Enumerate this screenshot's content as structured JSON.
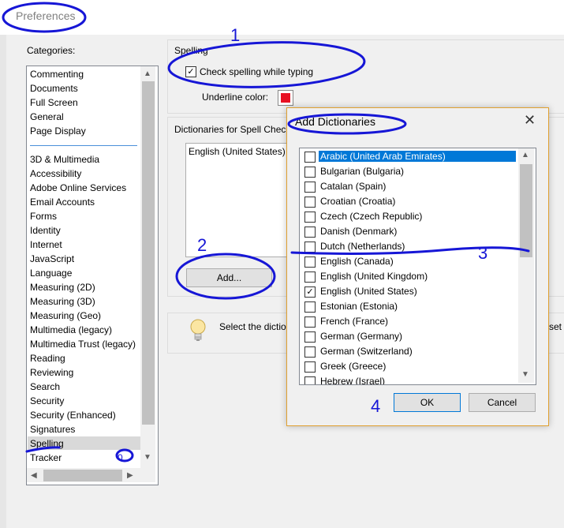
{
  "window": {
    "title": "Preferences"
  },
  "categories": {
    "label": "Categories:",
    "top_items": [
      "Commenting",
      "Documents",
      "Full Screen",
      "General",
      "Page Display"
    ],
    "items": [
      "3D & Multimedia",
      "Accessibility",
      "Adobe Online Services",
      "Email Accounts",
      "Forms",
      "Identity",
      "Internet",
      "JavaScript",
      "Language",
      "Measuring (2D)",
      "Measuring (3D)",
      "Measuring (Geo)",
      "Multimedia (legacy)",
      "Multimedia Trust (legacy)",
      "Reading",
      "Reviewing",
      "Search",
      "Security",
      "Security (Enhanced)",
      "Signatures",
      "Spelling",
      "Tracker"
    ],
    "selected": "Spelling"
  },
  "spelling": {
    "group_title": "Spelling",
    "check_label": "Check spelling while typing",
    "check_checked": true,
    "underline_label": "Underline color:",
    "underline_color": "#e81123",
    "dictionaries_title": "Dictionaries for Spell Check",
    "dictionaries": [
      "English (United States)"
    ],
    "add_button": "Add...",
    "hint_text": "Select the dictio",
    "hint_text_right": "set t"
  },
  "dialog": {
    "title": "Add Dictionaries",
    "close_glyph": "✕",
    "items": [
      {
        "label": "Arabic (United Arab Emirates)",
        "checked": false,
        "selected": true
      },
      {
        "label": "Bulgarian (Bulgaria)",
        "checked": false
      },
      {
        "label": "Catalan (Spain)",
        "checked": false
      },
      {
        "label": "Croatian (Croatia)",
        "checked": false
      },
      {
        "label": "Czech (Czech Republic)",
        "checked": false
      },
      {
        "label": "Danish (Denmark)",
        "checked": false
      },
      {
        "label": "Dutch (Netherlands)",
        "checked": false
      },
      {
        "label": "English (Canada)",
        "checked": false
      },
      {
        "label": "English (United Kingdom)",
        "checked": false
      },
      {
        "label": "English (United States)",
        "checked": true
      },
      {
        "label": "Estonian (Estonia)",
        "checked": false
      },
      {
        "label": "French (France)",
        "checked": false
      },
      {
        "label": "German (Germany)",
        "checked": false
      },
      {
        "label": "German (Switzerland)",
        "checked": false
      },
      {
        "label": "Greek (Greece)",
        "checked": false
      },
      {
        "label": "Hebrew (Israel)",
        "checked": false
      }
    ],
    "ok_button": "OK",
    "cancel_button": "Cancel"
  },
  "annotations": {
    "step1": "1",
    "step2": "2",
    "step3": "3",
    "step4": "4",
    "step5": "0",
    "ink_color": "#1616d6"
  },
  "glyphs": {
    "up": "▲",
    "down": "▼",
    "left": "◀",
    "right": "▶",
    "check": "✓"
  }
}
